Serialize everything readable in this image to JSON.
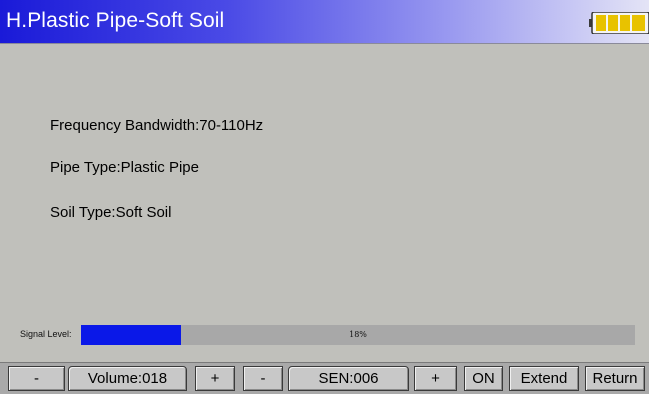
{
  "title": "H.Plastic Pipe-Soft Soil",
  "battery": {
    "icon": "battery-icon",
    "level": 0.75,
    "color": "#e8c200"
  },
  "info": {
    "frequency": "Frequency Bandwidth:70-110Hz",
    "pipe_type": "Pipe Type:Plastic Pipe",
    "soil_type": "Soil Type:Soft Soil"
  },
  "signal": {
    "label": "Signal Level:",
    "percent_text": "18%",
    "level": 0.18,
    "fill_color": "#0a18e8"
  },
  "toolbar": {
    "volume_down": "-",
    "volume": "Volume:018",
    "volume_up": "+",
    "sen_down": "-",
    "sen": "SEN:006",
    "sen_up": "+",
    "on": "ON",
    "extend": "Extend",
    "return": "Return"
  }
}
